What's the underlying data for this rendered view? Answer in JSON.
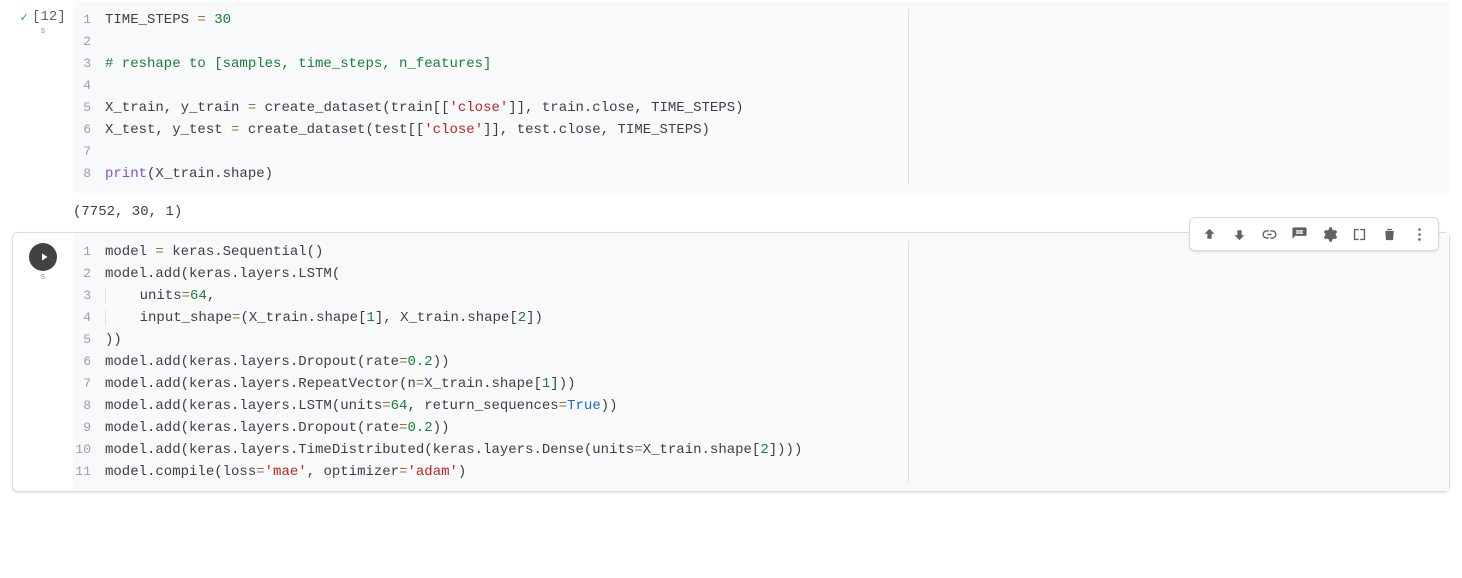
{
  "cells": [
    {
      "exec_count": "[12]",
      "status": "executed",
      "lines": [
        {
          "n": "1",
          "html": "TIME_STEPS <span class='tok-op'>=</span> <span class='tok-num'>30</span>"
        },
        {
          "n": "2",
          "html": ""
        },
        {
          "n": "3",
          "html": "<span class='tok-comment'># reshape to [samples, time_steps, n_features]</span>"
        },
        {
          "n": "4",
          "html": ""
        },
        {
          "n": "5",
          "html": "X_train, y_train <span class='tok-op'>=</span> create_dataset(train[[<span class='tok-str'>'close'</span>]], train.close, TIME_STEPS)"
        },
        {
          "n": "6",
          "html": "X_test, y_test <span class='tok-op'>=</span> create_dataset(test[[<span class='tok-str'>'close'</span>]], test.close, TIME_STEPS)"
        },
        {
          "n": "7",
          "html": ""
        },
        {
          "n": "8",
          "html": "<span class='tok-builtin'>print</span>(X_train.shape)"
        }
      ],
      "output": "(7752, 30, 1)"
    },
    {
      "exec_count": "",
      "status": "runnable",
      "lines": [
        {
          "n": "1",
          "html": "model <span class='tok-op'>=</span> keras.Sequential()"
        },
        {
          "n": "2",
          "html": "model.add(keras.layers.LSTM("
        },
        {
          "n": "3",
          "html": "<span class='indent-guide'>   </span> units<span class='tok-op'>=</span><span class='tok-num'>64</span>,"
        },
        {
          "n": "4",
          "html": "<span class='indent-guide'>   </span> input_shape<span class='tok-op'>=</span>(X_train.shape[<span class='tok-num'>1</span>], X_train.shape[<span class='tok-num'>2</span>])"
        },
        {
          "n": "5",
          "html": "))"
        },
        {
          "n": "6",
          "html": "model.add(keras.layers.Dropout(rate<span class='tok-op'>=</span><span class='tok-num'>0.2</span>))"
        },
        {
          "n": "7",
          "html": "model.add(keras.layers.RepeatVector(n<span class='tok-op'>=</span>X_train.shape[<span class='tok-num'>1</span>]))"
        },
        {
          "n": "8",
          "html": "model.add(keras.layers.LSTM(units<span class='tok-op'>=</span><span class='tok-num'>64</span>, return_sequences<span class='tok-op'>=</span><span class='tok-const'>True</span>))"
        },
        {
          "n": "9",
          "html": "model.add(keras.layers.Dropout(rate<span class='tok-op'>=</span><span class='tok-num'>0.2</span>))"
        },
        {
          "n": "10",
          "html": "model.add(keras.layers.TimeDistributed(keras.layers.Dense(units<span class='tok-op'>=</span>X_train.shape[<span class='tok-num'>2</span>])))"
        },
        {
          "n": "11",
          "html": "model.compile(loss<span class='tok-op'>=</span><span class='tok-str'>'mae'</span>, optimizer<span class='tok-op'>=</span><span class='tok-str'>'adam'</span>)"
        }
      ],
      "output": ""
    }
  ],
  "toolbar_icons": [
    "arrow-up",
    "arrow-down",
    "link",
    "comment",
    "settings",
    "mirror",
    "delete",
    "more"
  ],
  "seconds_label": "s"
}
